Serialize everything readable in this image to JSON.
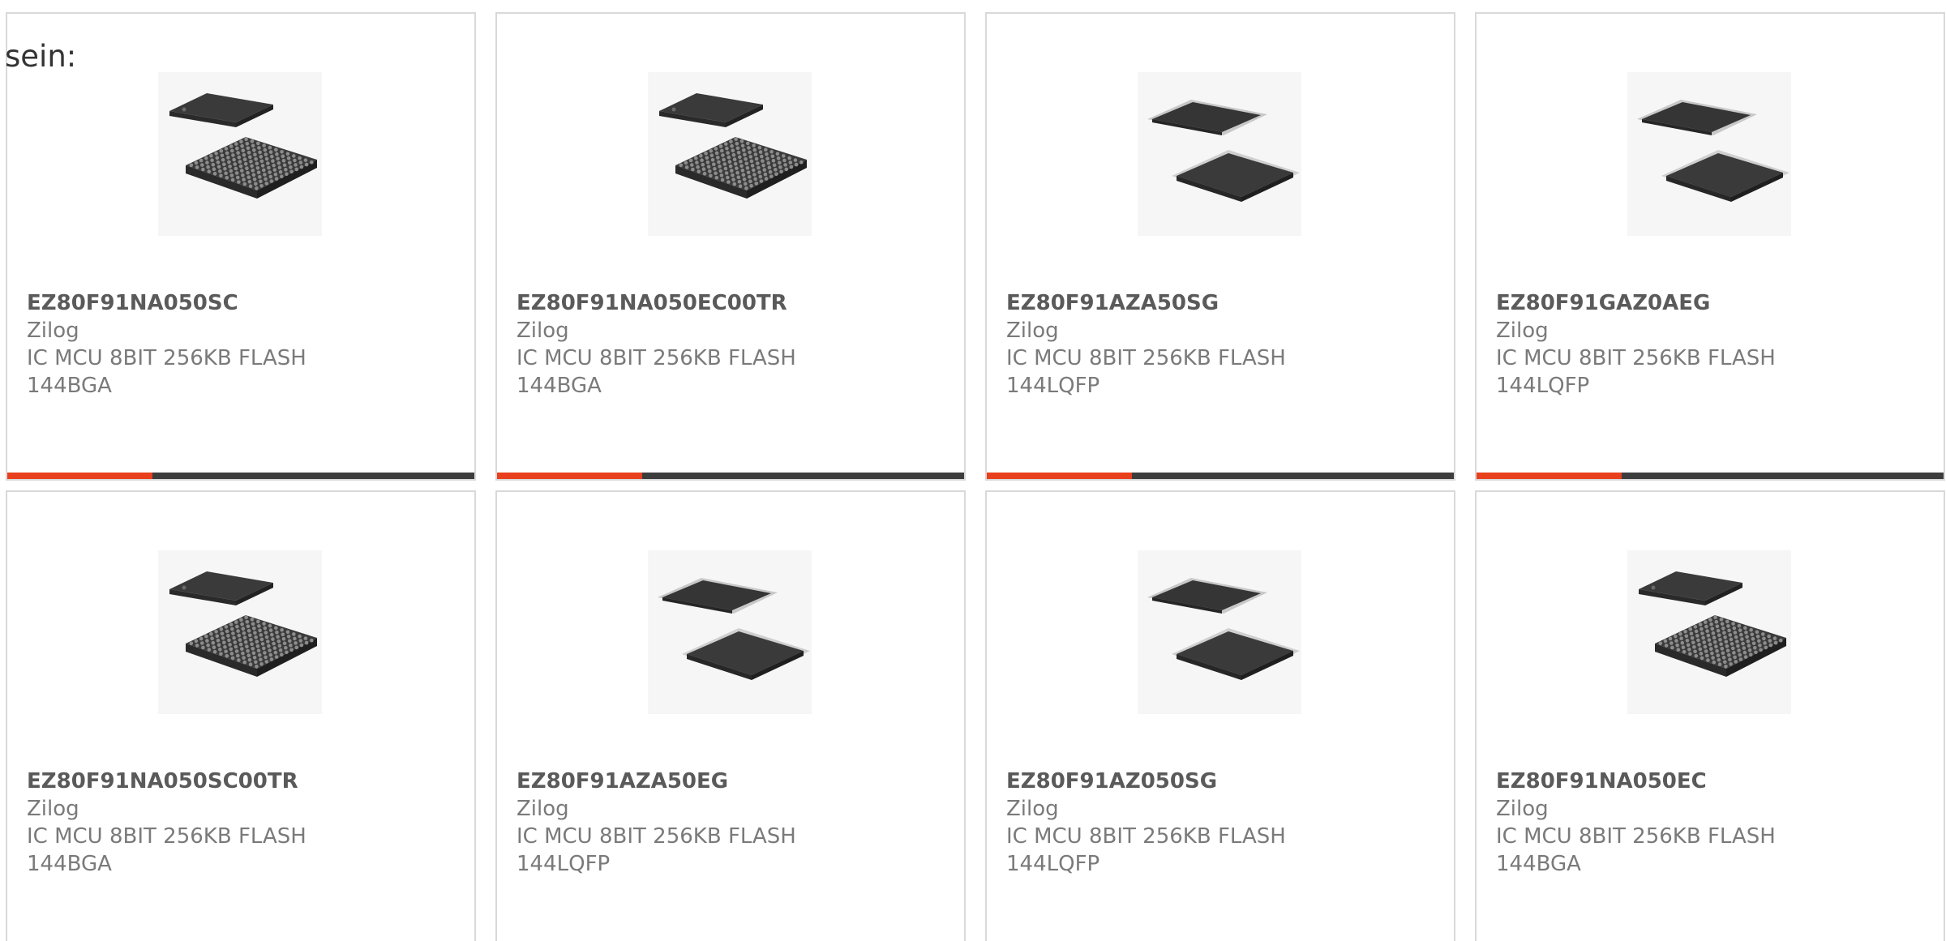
{
  "intro": {
    "text": "sein:"
  },
  "colors": {
    "accent": "#e8401c",
    "bar": "#3d3d3d",
    "border": "#d9d9d9"
  },
  "products": [
    {
      "part": "EZ80F91NA050SC",
      "maker": "Zilog",
      "description": "IC MCU 8BIT 256KB FLASH 144BGA",
      "package_icon": "bga-chip-icon",
      "bar_accent": 0.31,
      "show_bar": true
    },
    {
      "part": "EZ80F91NA050EC00TR",
      "maker": "Zilog",
      "description": "IC MCU 8BIT 256KB FLASH 144BGA",
      "package_icon": "bga-chip-icon",
      "bar_accent": 0.31,
      "show_bar": true
    },
    {
      "part": "EZ80F91AZA50SG",
      "maker": "Zilog",
      "description": "IC MCU 8BIT 256KB FLASH 144LQFP",
      "package_icon": "lqfp-chip-icon",
      "bar_accent": 0.31,
      "show_bar": true
    },
    {
      "part": "EZ80F91GAZ0AEG",
      "maker": "Zilog",
      "description": "IC MCU 8BIT 256KB FLASH 144LQFP",
      "package_icon": "lqfp-chip-icon",
      "bar_accent": 0.31,
      "show_bar": true
    },
    {
      "part": "EZ80F91NA050SC00TR",
      "maker": "Zilog",
      "description": "IC MCU 8BIT 256KB FLASH 144BGA",
      "package_icon": "bga-chip-icon",
      "bar_accent": 0.31,
      "show_bar": false
    },
    {
      "part": "EZ80F91AZA50EG",
      "maker": "Zilog",
      "description": "IC MCU 8BIT 256KB FLASH 144LQFP",
      "package_icon": "lqfp-chip-icon",
      "bar_accent": 0.31,
      "show_bar": false
    },
    {
      "part": "EZ80F91AZ050SG",
      "maker": "Zilog",
      "description": "IC MCU 8BIT 256KB FLASH 144LQFP",
      "package_icon": "lqfp-chip-icon",
      "bar_accent": 0.31,
      "show_bar": false
    },
    {
      "part": "EZ80F91NA050EC",
      "maker": "Zilog",
      "description": "IC MCU 8BIT 256KB FLASH 144BGA",
      "package_icon": "bga-chip-icon",
      "bar_accent": 0.31,
      "show_bar": false
    }
  ]
}
